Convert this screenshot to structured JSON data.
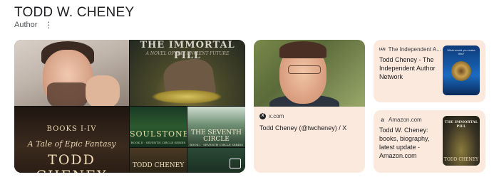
{
  "header": {
    "title": "TODD W. CHENEY",
    "subtitle": "Author",
    "more_icon": "vertical-dots-icon"
  },
  "collage": {
    "cover_immortal_pill": {
      "title": "THE IMMORTAL PILL",
      "subtitle": "A NOVEL OF THE ANCIENT FUTURE"
    },
    "cover_tale_epic": {
      "line1": "BOOKS I-IV",
      "line2": "A Tale of Epic Fantasy",
      "author": "TODD CHENEY"
    },
    "cover_soulstone": {
      "title": "SOULSTONE",
      "series": "BOOK II · SEVENTH CIRCLE SERIES"
    },
    "cover_seventh_circle": {
      "title_line1": "THE SEVENTH",
      "title_line2": "CIRCLE",
      "series": "BOOK I · SEVENTH CIRCLE SERIES"
    },
    "cover_todd_cheney_small": {
      "author": "TODD CHENEY"
    },
    "more_images_icon": "image-gallery-icon"
  },
  "cards": {
    "x": {
      "source": "x.com",
      "source_icon": "x-logo-icon",
      "title": "Todd Cheney (@twcheney) / X"
    },
    "independent": {
      "source": "The Independent A...",
      "source_icon": "ian-logo-icon",
      "title": "Todd Cheney - The Independent Author Network",
      "thumb_caption": "What would you make this?"
    },
    "amazon": {
      "source": "Amazon.com",
      "source_icon": "amazon-logo-icon",
      "title": "Todd W. Cheney: books, biography, latest update - Amazon.com",
      "thumb_title": "THE IMMORTAL PILL",
      "thumb_author": "TODD CHENEY"
    }
  },
  "colors": {
    "card_bg": "#fce9dd",
    "text": "#202124",
    "muted": "#4d5156"
  }
}
